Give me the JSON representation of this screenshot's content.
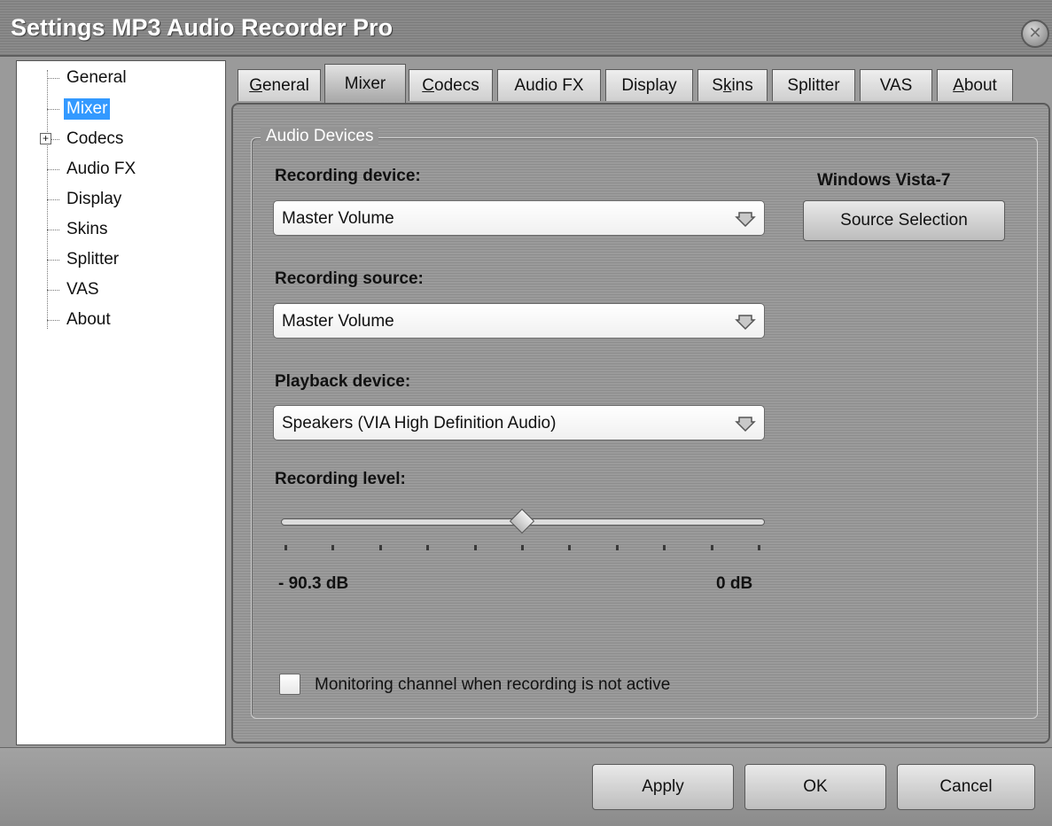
{
  "window": {
    "title": "Settings MP3 Audio Recorder Pro",
    "close_glyph": "✕"
  },
  "tree": {
    "items": [
      {
        "label": "General"
      },
      {
        "label": "Mixer"
      },
      {
        "label": "Codecs"
      },
      {
        "label": "Audio FX"
      },
      {
        "label": "Display"
      },
      {
        "label": "Skins"
      },
      {
        "label": "Splitter"
      },
      {
        "label": "VAS"
      },
      {
        "label": "About"
      }
    ],
    "selected": "Mixer",
    "expander_glyph": "+"
  },
  "tabs": [
    {
      "pre": "",
      "u": "G",
      "post": "eneral"
    },
    {
      "pre": "Mixer",
      "u": "",
      "post": ""
    },
    {
      "pre": "",
      "u": "C",
      "post": "odecs"
    },
    {
      "pre": "Audio FX",
      "u": "",
      "post": ""
    },
    {
      "pre": "Display",
      "u": "",
      "post": ""
    },
    {
      "pre": "S",
      "u": "k",
      "post": "ins"
    },
    {
      "pre": "Splitter",
      "u": "",
      "post": ""
    },
    {
      "pre": "VAS",
      "u": "",
      "post": ""
    },
    {
      "pre": "",
      "u": "A",
      "post": "bout"
    }
  ],
  "active_tab": "Mixer",
  "mixer": {
    "group_title": "Audio Devices",
    "recording_device_label": "Recording device:",
    "recording_device_value": "Master Volume",
    "recording_source_label": "Recording source:",
    "recording_source_value": "Master Volume",
    "playback_device_label": "Playback device:",
    "playback_device_value": "Speakers (VIA High Definition Audio)",
    "recording_level_label": "Recording level:",
    "recording_level_fraction": 0.5,
    "level_min": "- 90.3 dB",
    "level_max": "0 dB",
    "os_label": "Windows Vista-7",
    "source_selection_button": "Source Selection",
    "monitoring_checkbox_label": "Monitoring channel when recording is not active",
    "monitoring_checked": false
  },
  "buttons": {
    "apply": "Apply",
    "ok": "OK",
    "cancel": "Cancel"
  },
  "icons": {
    "dropdown": "chevron-down-icon",
    "close": "close-icon",
    "expander": "plus-icon"
  }
}
